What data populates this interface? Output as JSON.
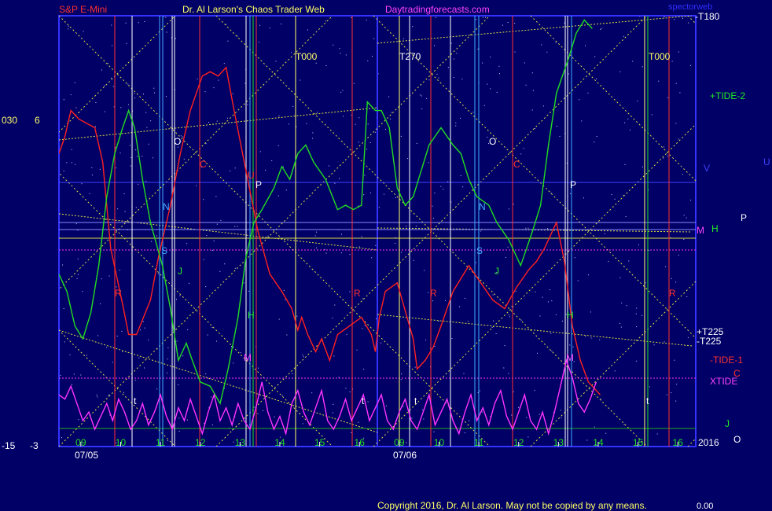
{
  "header": {
    "symbol": "S&P E-Mini",
    "site": "Dr. Al Larson's Chaos Trader Web",
    "domain": "Daytradingforecasts.com",
    "corner": "spectorweb"
  },
  "footer": {
    "copyright": "Copyright 2016, Dr. Al Larson. May not be copied by any means.",
    "value": "0.00"
  },
  "colors": {
    "background": "#000066",
    "frame": "#3333ff",
    "price": "#ff2020",
    "tide": "#22dd22",
    "xtide": "#ff33ff",
    "grid_yellow": "#dddd44",
    "grid_blue": "#4040ff"
  },
  "chart_data": {
    "type": "line",
    "x_ticks": [
      "09",
      "10",
      "11",
      "12",
      "13",
      "14",
      "15",
      "16",
      "09",
      "10",
      "11",
      "12",
      "13",
      "14",
      "15",
      "16"
    ],
    "dates": [
      "07/05",
      "07/06"
    ],
    "year": "2016",
    "left_axis_labels": {
      "top_outer": "030",
      "top_inner": "6",
      "bottom_outer": "-15",
      "bottom_inner": "-3"
    },
    "right_labels": {
      "t180": "-T180",
      "tide2": "+TIDE-2",
      "v": "V",
      "u": "U",
      "m": "M",
      "h": "H",
      "p": "P",
      "t225p": "+T225",
      "t225m": "-T225",
      "tide1": "-TIDE-1",
      "c": "C",
      "xtide": "XTIDE",
      "j": "J",
      "o": "O"
    },
    "markers": {
      "t000a": "T000",
      "t270": "T270",
      "t000b": "T000",
      "o": "O",
      "n": "N",
      "s": "S",
      "j": "J",
      "c": "C",
      "p": "P",
      "u": "U",
      "r": "R",
      "h": "H",
      "m": "M",
      "t": "t"
    },
    "series": [
      {
        "name": "",
        "color": "#ff2020",
        "points": [
          [
            0,
            0.68
          ],
          [
            0.15,
            0.72
          ],
          [
            0.3,
            0.78
          ],
          [
            0.5,
            0.76
          ],
          [
            0.9,
            0.74
          ],
          [
            1.1,
            0.66
          ],
          [
            1.3,
            0.46
          ],
          [
            1.6,
            0.33
          ],
          [
            1.75,
            0.26
          ],
          [
            1.95,
            0.26
          ],
          [
            2.3,
            0.34
          ],
          [
            2.5,
            0.44
          ],
          [
            2.8,
            0.56
          ],
          [
            3.05,
            0.68
          ],
          [
            3.3,
            0.78
          ],
          [
            3.6,
            0.86
          ],
          [
            3.8,
            0.87
          ],
          [
            4.0,
            0.86
          ],
          [
            4.2,
            0.88
          ],
          [
            4.4,
            0.78
          ],
          [
            4.7,
            0.64
          ],
          [
            5.0,
            0.5
          ],
          [
            5.3,
            0.4
          ],
          [
            5.6,
            0.36
          ],
          [
            5.85,
            0.32
          ],
          [
            6.0,
            0.27
          ],
          [
            6.1,
            0.3
          ],
          [
            6.25,
            0.26
          ],
          [
            6.45,
            0.22
          ],
          [
            6.6,
            0.25
          ],
          [
            6.8,
            0.2
          ],
          [
            7.0,
            0.26
          ],
          [
            7.3,
            0.28
          ],
          [
            7.6,
            0.3
          ],
          [
            7.85,
            0.26
          ],
          [
            7.95,
            0.22
          ],
          [
            8.05,
            0.3
          ],
          [
            8.2,
            0.36
          ],
          [
            8.5,
            0.38
          ],
          [
            8.9,
            0.25
          ],
          [
            9.0,
            0.18
          ],
          [
            9.2,
            0.2
          ],
          [
            9.4,
            0.23
          ],
          [
            9.6,
            0.28
          ],
          [
            9.9,
            0.36
          ],
          [
            10.3,
            0.42
          ],
          [
            10.6,
            0.38
          ],
          [
            10.9,
            0.34
          ],
          [
            11.2,
            0.32
          ],
          [
            11.5,
            0.37
          ],
          [
            11.8,
            0.41
          ],
          [
            12.0,
            0.43
          ],
          [
            12.2,
            0.46
          ],
          [
            12.5,
            0.52
          ],
          [
            12.7,
            0.43
          ],
          [
            12.9,
            0.28
          ],
          [
            13.1,
            0.2
          ],
          [
            13.3,
            0.15
          ],
          [
            13.6,
            0.12
          ]
        ]
      },
      {
        "name": "",
        "color": "#22dd22",
        "points": [
          [
            0,
            0.4
          ],
          [
            0.2,
            0.36
          ],
          [
            0.4,
            0.28
          ],
          [
            0.6,
            0.25
          ],
          [
            0.8,
            0.31
          ],
          [
            1.0,
            0.42
          ],
          [
            1.2,
            0.58
          ],
          [
            1.4,
            0.68
          ],
          [
            1.6,
            0.74
          ],
          [
            1.75,
            0.78
          ],
          [
            1.9,
            0.74
          ],
          [
            2.1,
            0.62
          ],
          [
            2.3,
            0.52
          ],
          [
            2.6,
            0.42
          ],
          [
            2.8,
            0.32
          ],
          [
            3.0,
            0.2
          ],
          [
            3.2,
            0.24
          ],
          [
            3.35,
            0.2
          ],
          [
            3.55,
            0.15
          ],
          [
            3.8,
            0.14
          ],
          [
            4.05,
            0.1
          ],
          [
            4.25,
            0.18
          ],
          [
            4.5,
            0.3
          ],
          [
            4.7,
            0.44
          ],
          [
            4.9,
            0.52
          ],
          [
            5.1,
            0.55
          ],
          [
            5.4,
            0.6
          ],
          [
            5.6,
            0.65
          ],
          [
            5.8,
            0.62
          ],
          [
            6.0,
            0.68
          ],
          [
            6.2,
            0.7
          ],
          [
            6.4,
            0.66
          ],
          [
            6.7,
            0.62
          ],
          [
            7.0,
            0.55
          ],
          [
            7.2,
            0.56
          ],
          [
            7.4,
            0.55
          ],
          [
            7.6,
            0.56
          ],
          [
            7.75,
            0.8
          ],
          [
            7.95,
            0.78
          ],
          [
            8.1,
            0.78
          ],
          [
            8.3,
            0.74
          ],
          [
            8.5,
            0.6
          ],
          [
            8.7,
            0.56
          ],
          [
            8.9,
            0.58
          ],
          [
            9.1,
            0.64
          ],
          [
            9.3,
            0.7
          ],
          [
            9.6,
            0.74
          ],
          [
            9.9,
            0.7
          ],
          [
            10.1,
            0.68
          ],
          [
            10.3,
            0.62
          ],
          [
            10.5,
            0.58
          ],
          [
            10.8,
            0.56
          ],
          [
            11.0,
            0.52
          ],
          [
            11.3,
            0.48
          ],
          [
            11.6,
            0.42
          ],
          [
            11.9,
            0.5
          ],
          [
            12.1,
            0.56
          ],
          [
            12.3,
            0.7
          ],
          [
            12.5,
            0.82
          ],
          [
            12.8,
            0.9
          ],
          [
            13.0,
            0.96
          ],
          [
            13.2,
            0.99
          ],
          [
            13.4,
            0.97
          ]
        ]
      },
      {
        "name": "",
        "color": "#ff33ff",
        "points": [
          [
            0,
            0.12
          ],
          [
            0.15,
            0.11
          ],
          [
            0.3,
            0.14
          ],
          [
            0.45,
            0.1
          ],
          [
            0.6,
            0.06
          ],
          [
            0.75,
            0.08
          ],
          [
            0.9,
            0.04
          ],
          [
            1.05,
            0.07
          ],
          [
            1.2,
            0.1
          ],
          [
            1.35,
            0.06
          ],
          [
            1.5,
            0.11
          ],
          [
            1.65,
            0.08
          ],
          [
            1.8,
            0.04
          ],
          [
            1.95,
            0.06
          ],
          [
            2.1,
            0.1
          ],
          [
            2.25,
            0.05
          ],
          [
            2.4,
            0.08
          ],
          [
            2.55,
            0.12
          ],
          [
            2.7,
            0.07
          ],
          [
            2.85,
            0.04
          ],
          [
            3.0,
            0.09
          ],
          [
            3.15,
            0.06
          ],
          [
            3.3,
            0.11
          ],
          [
            3.45,
            0.07
          ],
          [
            3.6,
            0.03
          ],
          [
            3.75,
            0.08
          ],
          [
            3.9,
            0.12
          ],
          [
            4.05,
            0.06
          ],
          [
            4.2,
            0.09
          ],
          [
            4.35,
            0.05
          ],
          [
            4.5,
            0.1
          ],
          [
            4.65,
            0.06
          ],
          [
            4.8,
            0.04
          ],
          [
            4.95,
            0.09
          ],
          [
            5.1,
            0.15
          ],
          [
            5.25,
            0.08
          ],
          [
            5.4,
            0.04
          ],
          [
            5.55,
            0.07
          ],
          [
            5.7,
            0.03
          ],
          [
            5.85,
            0.1
          ],
          [
            6.0,
            0.13
          ],
          [
            6.15,
            0.08
          ],
          [
            6.3,
            0.05
          ],
          [
            6.45,
            0.09
          ],
          [
            6.6,
            0.13
          ],
          [
            6.75,
            0.06
          ],
          [
            6.9,
            0.04
          ],
          [
            7.05,
            0.07
          ],
          [
            7.2,
            0.11
          ],
          [
            7.35,
            0.06
          ],
          [
            7.5,
            0.09
          ],
          [
            7.65,
            0.12
          ],
          [
            7.8,
            0.06
          ],
          [
            7.95,
            0.09
          ],
          [
            8.1,
            0.12
          ],
          [
            8.25,
            0.06
          ],
          [
            8.4,
            0.04
          ],
          [
            8.55,
            0.08
          ],
          [
            8.7,
            0.11
          ],
          [
            8.85,
            0.06
          ],
          [
            9.0,
            0.04
          ],
          [
            9.15,
            0.08
          ],
          [
            9.3,
            0.12
          ],
          [
            9.45,
            0.05
          ],
          [
            9.6,
            0.08
          ],
          [
            9.75,
            0.11
          ],
          [
            9.9,
            0.06
          ],
          [
            10.05,
            0.03
          ],
          [
            10.2,
            0.08
          ],
          [
            10.35,
            0.12
          ],
          [
            10.5,
            0.06
          ],
          [
            10.65,
            0.09
          ],
          [
            10.8,
            0.05
          ],
          [
            10.95,
            0.1
          ],
          [
            11.1,
            0.13
          ],
          [
            11.25,
            0.07
          ],
          [
            11.4,
            0.04
          ],
          [
            11.55,
            0.08
          ],
          [
            11.7,
            0.12
          ],
          [
            11.85,
            0.06
          ],
          [
            12.0,
            0.04
          ],
          [
            12.15,
            0.08
          ],
          [
            12.3,
            0.03
          ],
          [
            12.45,
            0.08
          ],
          [
            12.6,
            0.14
          ],
          [
            12.75,
            0.2
          ],
          [
            12.9,
            0.16
          ],
          [
            13.05,
            0.1
          ],
          [
            13.2,
            0.08
          ],
          [
            13.35,
            0.11
          ],
          [
            13.5,
            0.15
          ]
        ]
      }
    ]
  }
}
